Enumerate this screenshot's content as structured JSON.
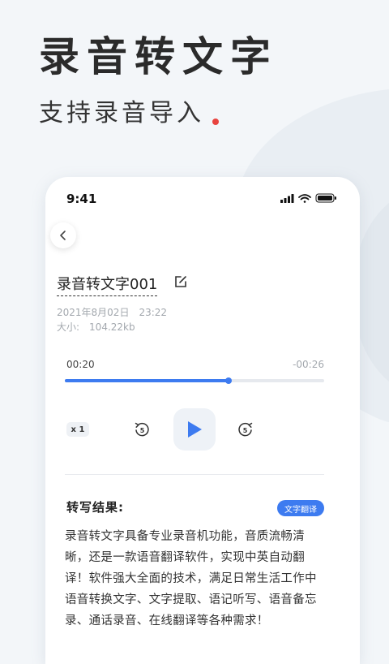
{
  "hero": {
    "title": "录音转文字",
    "subtitle": "支持录音导入"
  },
  "status_bar": {
    "time": "9:41",
    "icons": [
      "signal-icon",
      "wifi-icon",
      "battery-icon"
    ]
  },
  "recording": {
    "title": "录音转文字001",
    "date": "2021年8月02日　23:22",
    "size": "大小:　104.22kb"
  },
  "player": {
    "current_time": "00:20",
    "remaining_time": "-00:26",
    "progress": 0.63,
    "speed": "x 1",
    "skip_seconds": "5"
  },
  "result": {
    "label": "转写结果:",
    "translate_button": "文字翻译",
    "text": "录音转文字具备专业录音机功能，音质流畅清晰，还是一款语音翻译软件，实现中英自动翻译！软件强大全面的技术，满足日常生活工作中语音转换文字、文字提取、语记听写、语音备忘录、通话录音、在线翻译等各种需求！"
  },
  "colors": {
    "accent": "#3d7bf0",
    "dot": "#e8433f",
    "background": "#f3f6f9"
  }
}
